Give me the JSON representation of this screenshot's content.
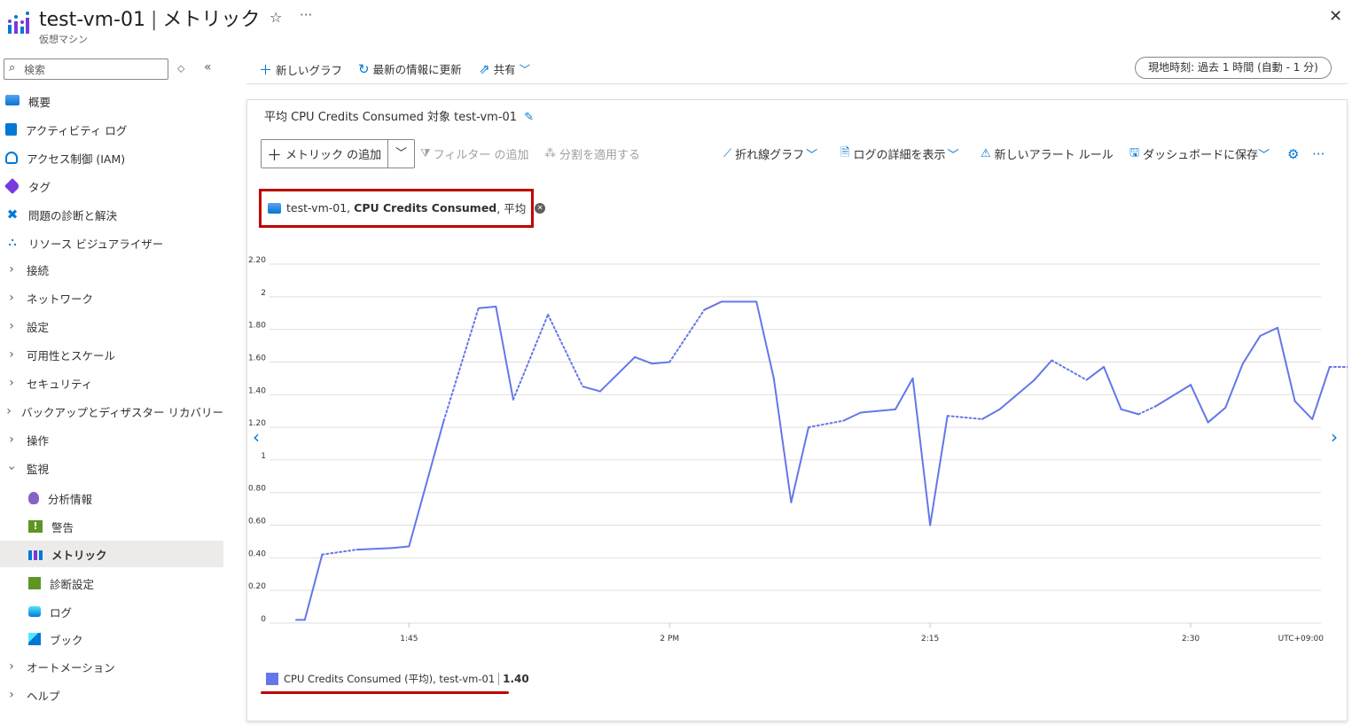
{
  "header": {
    "resource_name": "test-vm-01",
    "separator": "|",
    "blade_title": "メトリック",
    "subtitle": "仮想マシン",
    "favorite_icon": "star-icon",
    "more_icon": "ellipsis-icon",
    "close_icon": "close-icon"
  },
  "sidebar": {
    "search_placeholder": "検索",
    "items": [
      {
        "label": "概要",
        "icon": "monitor-icon"
      },
      {
        "label": "アクティビティ ログ",
        "icon": "activity-log-icon"
      },
      {
        "label": "アクセス制御 (IAM)",
        "icon": "people-icon"
      },
      {
        "label": "タグ",
        "icon": "tag-icon"
      },
      {
        "label": "問題の診断と解決",
        "icon": "wrench-icon"
      },
      {
        "label": "リソース ビジュアライザー",
        "icon": "hierarchy-icon"
      },
      {
        "label": "接続",
        "icon": "chevron-right-icon"
      },
      {
        "label": "ネットワーク",
        "icon": "chevron-right-icon"
      },
      {
        "label": "設定",
        "icon": "chevron-right-icon"
      },
      {
        "label": "可用性とスケール",
        "icon": "chevron-right-icon"
      },
      {
        "label": "セキュリティ",
        "icon": "chevron-right-icon"
      },
      {
        "label": "バックアップとディザスター リカバリー",
        "icon": "chevron-right-icon"
      },
      {
        "label": "操作",
        "icon": "chevron-right-icon"
      },
      {
        "label": "監視",
        "icon": "chevron-down-icon"
      },
      {
        "label": "分析情報",
        "icon": "lightbulb-icon"
      },
      {
        "label": "警告",
        "icon": "alert-icon"
      },
      {
        "label": "メトリック",
        "icon": "metrics-icon"
      },
      {
        "label": "診断設定",
        "icon": "diagnostics-icon"
      },
      {
        "label": "ログ",
        "icon": "logs-icon"
      },
      {
        "label": "ブック",
        "icon": "workbook-icon"
      },
      {
        "label": "オートメーション",
        "icon": "chevron-right-icon"
      },
      {
        "label": "ヘルプ",
        "icon": "chevron-right-icon"
      }
    ]
  },
  "commands": {
    "new_chart": "新しいグラフ",
    "refresh": "最新の情報に更新",
    "share": "共有",
    "time_range": "現地時刻: 過去 1 時間 (自動 - 1 分)"
  },
  "chart_card": {
    "title": "平均 CPU Credits Consumed 対象 test-vm-01",
    "add_metric": "メトリック の追加",
    "add_filter": "フィルター の追加",
    "apply_splitting": "分割を適用する",
    "line_chart": "折れ線グラフ",
    "view_logs": "ログの詳細を表示",
    "new_alert_rule": "新しいアラート ルール",
    "save_to_dashboard": "ダッシュボードに保存",
    "pill": {
      "resource": "test-vm-01,",
      "metric": "CPU Credits Consumed",
      "agg": ", 平均"
    },
    "bottom_legend": {
      "label": "CPU Credits Consumed (平均), test-vm-01",
      "value": "1.40"
    }
  },
  "colors": {
    "series": "#6477e8",
    "accent": "#0078d4",
    "highlight": "#c00000"
  },
  "chart_data": {
    "type": "line",
    "ylim": [
      0,
      2.2
    ],
    "yticks": [
      "2.20",
      "2",
      "1.80",
      "1.60",
      "1.40",
      "1.20",
      "1",
      "0.80",
      "0.60",
      "0.40",
      "0.20",
      "0"
    ],
    "xticks": [
      {
        "t": 45,
        "label": "1:45"
      },
      {
        "t": 60,
        "label": "2 PM"
      },
      {
        "t": 75,
        "label": "2:15"
      },
      {
        "t": 90,
        "label": "2:30"
      }
    ],
    "x_range_minutes": [
      38.5,
      97.5
    ],
    "timezone_label": "UTC+09:00",
    "series": [
      {
        "name": "CPU Credits Consumed (平均), test-vm-01",
        "points": [
          [
            38.5,
            0.02
          ],
          [
            39,
            0.02
          ],
          [
            40,
            0.42
          ],
          [
            42,
            0.45
          ],
          [
            44,
            0.46
          ],
          [
            45,
            0.47
          ],
          [
            47,
            1.24
          ],
          [
            49,
            1.93
          ],
          [
            50,
            1.94
          ],
          [
            51,
            1.37
          ],
          [
            53,
            1.89
          ],
          [
            55,
            1.45
          ],
          [
            56,
            1.42
          ],
          [
            58,
            1.63
          ],
          [
            59,
            1.59
          ],
          [
            60,
            1.6
          ],
          [
            62,
            1.92
          ],
          [
            63,
            1.97
          ],
          [
            65,
            1.97
          ],
          [
            66,
            1.5
          ],
          [
            67,
            0.74
          ],
          [
            68,
            1.2
          ],
          [
            70,
            1.24
          ],
          [
            71,
            1.29
          ],
          [
            73,
            1.31
          ],
          [
            74,
            1.5
          ],
          [
            75,
            0.6
          ],
          [
            76,
            1.27
          ],
          [
            78,
            1.25
          ],
          [
            79,
            1.31
          ],
          [
            81,
            1.49
          ],
          [
            82,
            1.61
          ],
          [
            84,
            1.49
          ],
          [
            85,
            1.57
          ],
          [
            86,
            1.31
          ],
          [
            87,
            1.28
          ],
          [
            88,
            1.33
          ],
          [
            90,
            1.46
          ],
          [
            91,
            1.23
          ],
          [
            92,
            1.32
          ],
          [
            93,
            1.59
          ],
          [
            94,
            1.76
          ],
          [
            95,
            1.81
          ],
          [
            96,
            1.36
          ],
          [
            97,
            1.25
          ],
          [
            98,
            1.57
          ],
          [
            100,
            1.57
          ]
        ],
        "missing_segments": [
          [
            40,
            42
          ],
          [
            47,
            49
          ],
          [
            51,
            53
          ],
          [
            53,
            55
          ],
          [
            60,
            62
          ],
          [
            68,
            70
          ],
          [
            76,
            78
          ],
          [
            82,
            84
          ],
          [
            87,
            88
          ],
          [
            98,
            100
          ]
        ]
      }
    ]
  }
}
